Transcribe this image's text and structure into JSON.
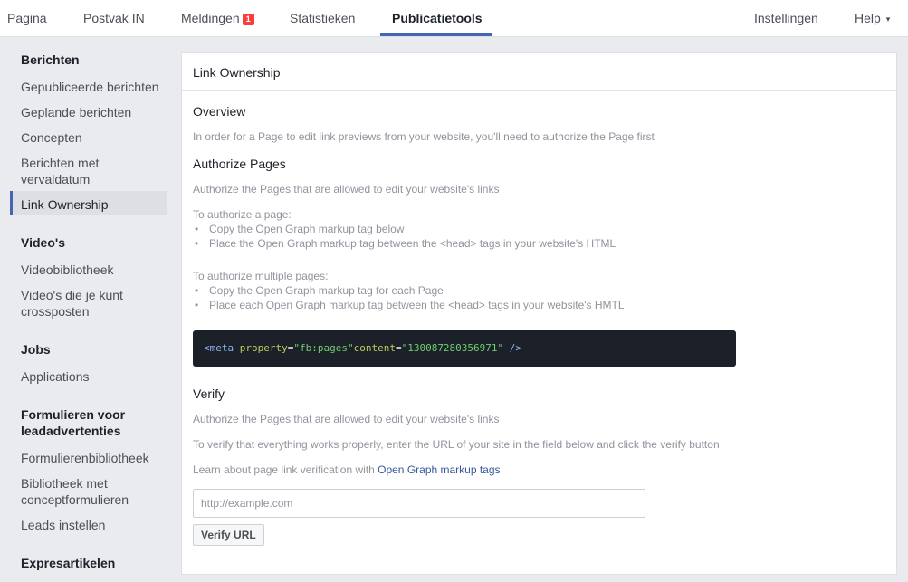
{
  "topnav": {
    "items": [
      {
        "label": "Pagina"
      },
      {
        "label": "Postvak IN"
      },
      {
        "label": "Meldingen",
        "badge": "1"
      },
      {
        "label": "Statistieken"
      },
      {
        "label": "Publicatietools",
        "active": true
      }
    ],
    "right": [
      {
        "label": "Instellingen"
      },
      {
        "label": "Help"
      }
    ],
    "help_caret": "▾",
    "accent_color": "#4267b2",
    "badge_color": "#fa3e3e"
  },
  "sidebar": {
    "sections": [
      {
        "title": "Berichten",
        "items": [
          "Gepubliceerde berichten",
          "Geplande berichten",
          "Concepten",
          "Berichten met vervaldatum",
          "Link Ownership"
        ],
        "active_item": "Link Ownership"
      },
      {
        "title": "Video's",
        "items": [
          "Videobibliotheek",
          "Video's die je kunt crossposten"
        ]
      },
      {
        "title": "Jobs",
        "items": [
          "Applications"
        ]
      },
      {
        "title": "Formulieren voor leadadvertenties",
        "items": [
          "Formulierenbibliotheek",
          "Bibliotheek met conceptformulieren",
          "Leads instellen"
        ]
      },
      {
        "title": "Expresartikelen",
        "items": []
      }
    ]
  },
  "main": {
    "title": "Link Ownership",
    "overview": {
      "heading": "Overview",
      "text": "In order for a Page to edit link previews from your website, you'll need to authorize the Page first"
    },
    "authorize": {
      "heading": "Authorize Pages",
      "text": "Authorize the Pages that are allowed to edit your website's links",
      "single_intro": "To authorize a page:",
      "single_steps": [
        "Copy the Open Graph markup tag below",
        "Place the Open Graph markup tag between the <head> tags in your website's HTML"
      ],
      "multi_intro": "To authorize multiple pages:",
      "multi_steps": [
        "Copy the Open Graph markup tag for each Page",
        "Place each Open Graph markup tag between the <head> tags in your website's HMTL"
      ]
    },
    "code": {
      "open": "<meta",
      "attr1": "property",
      "eq": "=",
      "val1": "\"fb:pages\"",
      "attr2": "content",
      "val2": "\"130087280356971\"",
      "close": "/>",
      "background": "#1c2029"
    },
    "verify": {
      "heading": "Verify",
      "text1": "Authorize the Pages that are allowed to edit your website's links",
      "text2": "To verify that everything works properly, enter the URL of your site in the field below and click the verify button",
      "learn_prefix": "Learn about page link verification with ",
      "learn_link": "Open Graph markup tags",
      "input_placeholder": "http://example.com",
      "input_value": "",
      "button_label": "Verify URL"
    }
  }
}
